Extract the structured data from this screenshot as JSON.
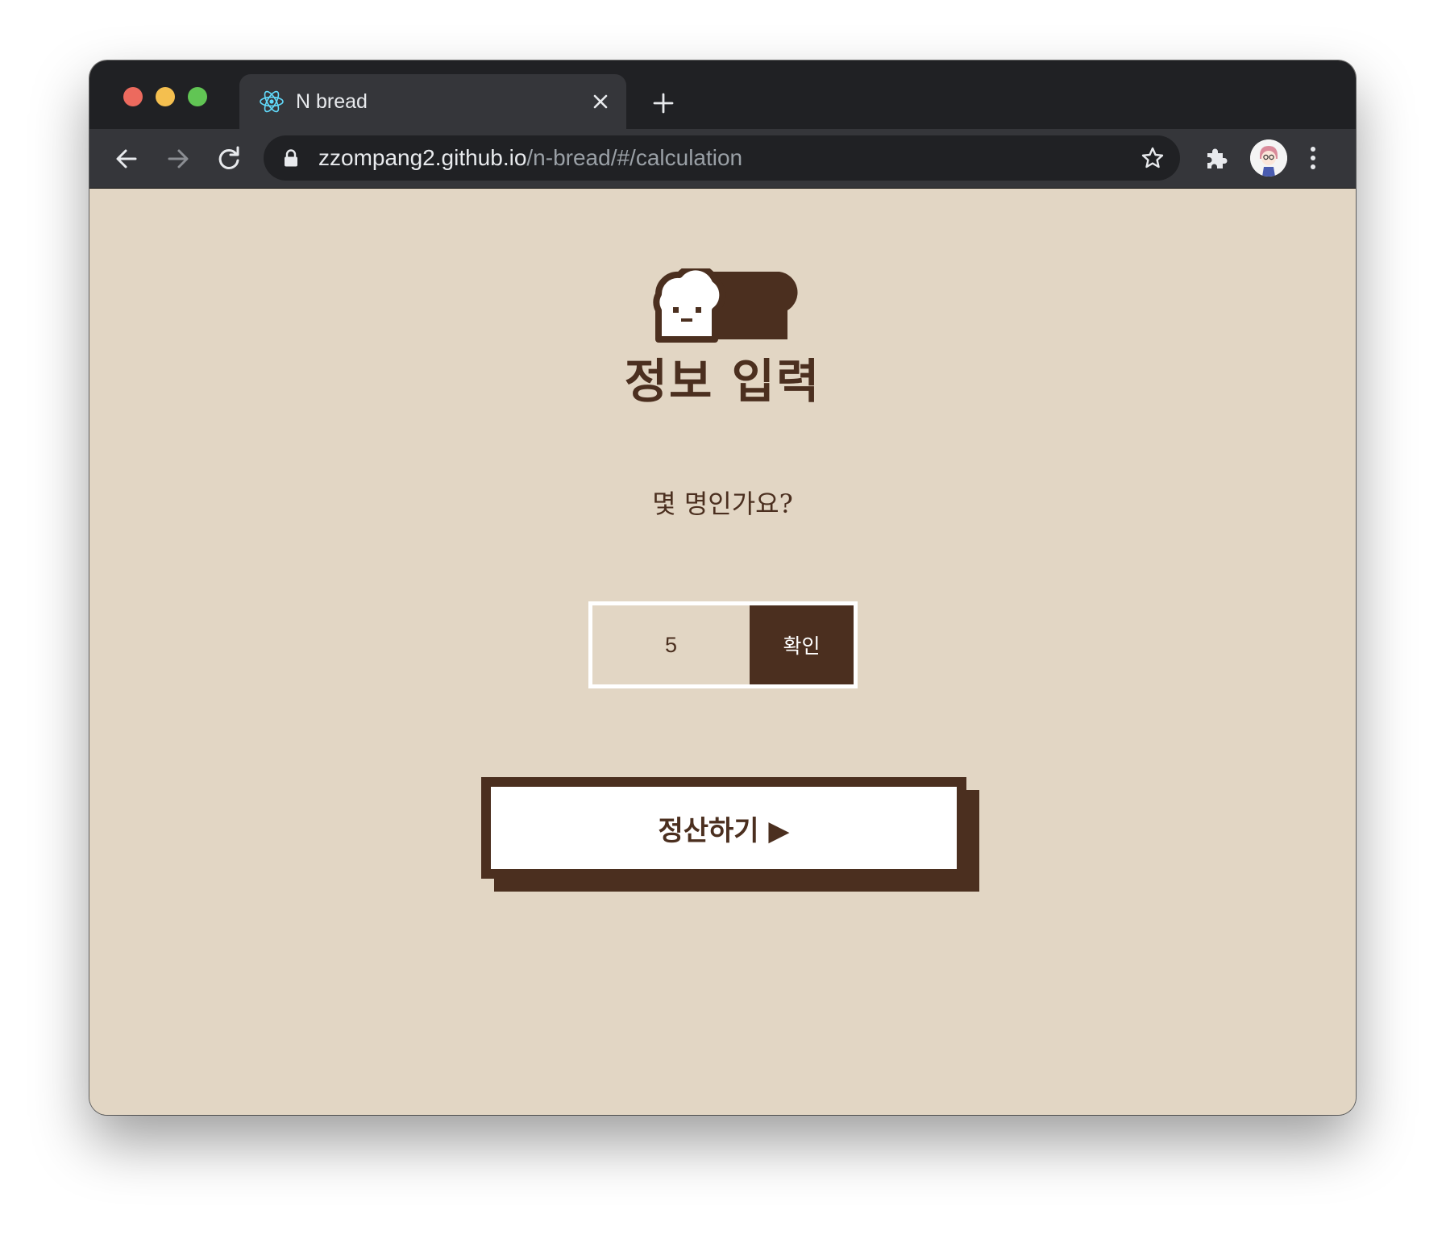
{
  "browser": {
    "tab": {
      "title": "N bread",
      "favicon": "react-logo-icon"
    },
    "new_tab_icon": "plus-icon",
    "toolbar": {
      "back_icon": "arrow-left-icon",
      "forward_icon": "arrow-right-icon",
      "reload_icon": "reload-icon",
      "extensions_icon": "puzzle-icon",
      "menu_icon": "kebab-menu-icon",
      "bookmark_icon": "star-icon"
    },
    "address_bar": {
      "host": "zzompang2.github.io",
      "path": "/n-bread/#/calculation"
    }
  },
  "page": {
    "logo_icon": "bread-loaf-icon",
    "title": "정보 입력",
    "question": "몇 명인가요?",
    "people_input": {
      "value": "5"
    },
    "confirm_button": "확인",
    "settle_button": "정산하기 ▶"
  },
  "colors": {
    "page_background": "#e2d6c4",
    "brand_brown": "#4b2f1f",
    "white": "#ffffff",
    "chrome_dark": "#202124",
    "chrome_toolbar": "#35363a"
  }
}
